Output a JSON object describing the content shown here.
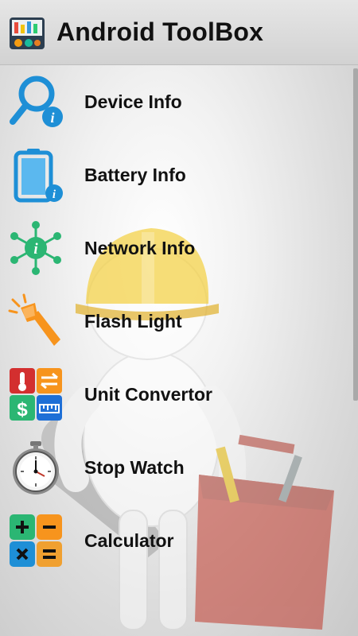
{
  "app": {
    "title": "Android ToolBox",
    "icon": "toolbox-app-icon"
  },
  "menu": [
    {
      "label": "Device Info",
      "icon": "magnifier-info-icon",
      "color": "#1e8fd6"
    },
    {
      "label": "Battery Info",
      "icon": "battery-info-icon",
      "color": "#1e8fd6"
    },
    {
      "label": "Network Info",
      "icon": "network-info-icon",
      "color": "#2bb673"
    },
    {
      "label": "Flash Light",
      "icon": "flashlight-icon",
      "color": "#f7941d"
    },
    {
      "label": "Unit Convertor",
      "icon": "unit-convertor-icon",
      "color": "#d32f2f"
    },
    {
      "label": "Stop Watch",
      "icon": "stopwatch-icon",
      "color": "#555555"
    },
    {
      "label": "Calculator",
      "icon": "calculator-icon",
      "color": "#1e8fd6"
    }
  ],
  "colors": {
    "actionbar": "#dcdcdc",
    "text": "#111111",
    "helmet": "#f4d03f",
    "toolbox": "#c0392b"
  }
}
